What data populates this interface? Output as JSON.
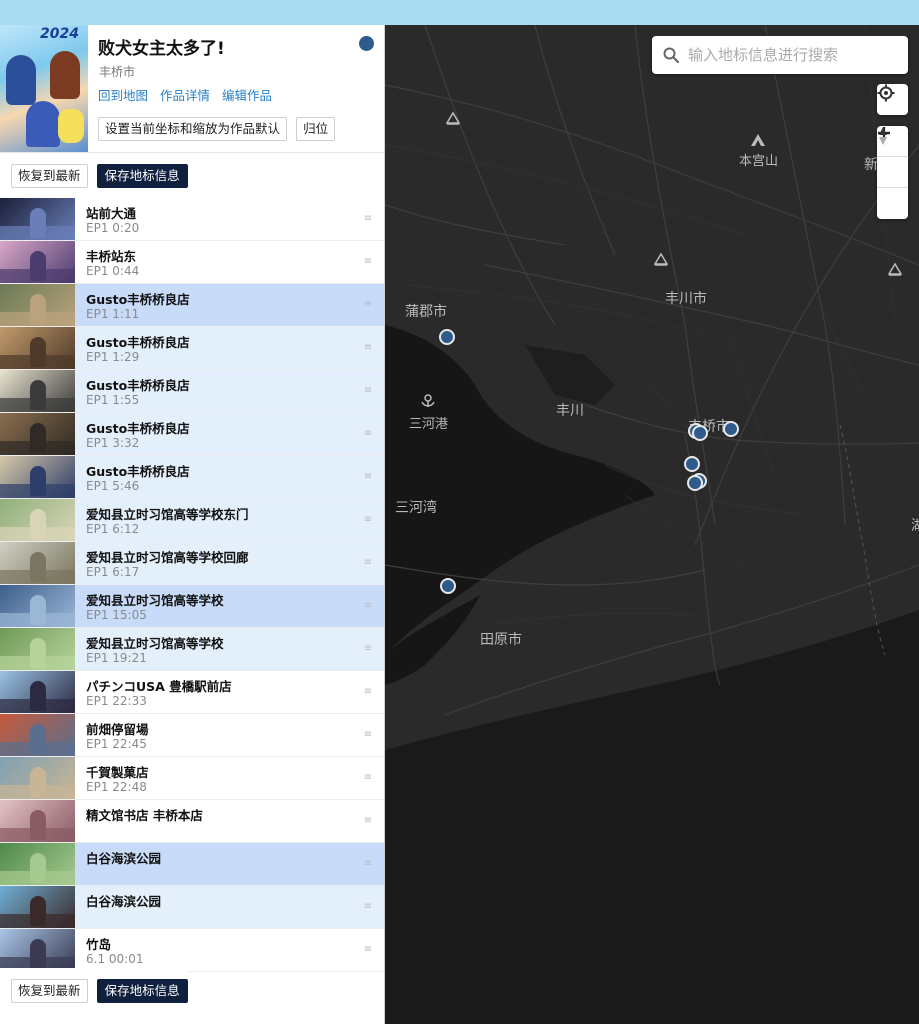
{
  "work": {
    "title": "败犬女主太多了!",
    "city": "丰桥市",
    "links": [
      "回到地图",
      "作品详情",
      "编辑作品"
    ],
    "set_default_label": "设置当前坐标和缩放为作品默认",
    "reset_label": "归位",
    "cover_year": "2024",
    "status_color": "#2f5b8c"
  },
  "actions": {
    "restore_label": "恢复到最新",
    "save_label": "保存地标信息"
  },
  "points": [
    {
      "name": "站前大通",
      "time": "EP1 0:20",
      "state": "none",
      "thumb": [
        "#1b1f3a",
        "#6a7fb8"
      ]
    },
    {
      "name": "丰桥站东",
      "time": "EP1 0:44",
      "state": "none",
      "thumb": [
        "#d9a7c7",
        "#4b3c6e"
      ]
    },
    {
      "name": "Gusto丰桥桥良店",
      "time": "EP1 1:11",
      "state": "hi",
      "thumb": [
        "#6b7a55",
        "#b9a27c"
      ]
    },
    {
      "name": "Gusto丰桥桥良店",
      "time": "EP1 1:29",
      "state": "sel",
      "thumb": [
        "#c29a6b",
        "#4e3a2a"
      ]
    },
    {
      "name": "Gusto丰桥桥良店",
      "time": "EP1 1:55",
      "state": "sel",
      "thumb": [
        "#e9e3cf",
        "#3b3b3b"
      ]
    },
    {
      "name": "Gusto丰桥桥良店",
      "time": "EP1 3:32",
      "state": "sel",
      "thumb": [
        "#8a6e4e",
        "#2f2a25"
      ]
    },
    {
      "name": "Gusto丰桥桥良店",
      "time": "EP1 5:46",
      "state": "sel",
      "thumb": [
        "#d8c9a9",
        "#2e3e6a"
      ]
    },
    {
      "name": "爱知县立时习馆高等学校东门",
      "time": "EP1 6:12",
      "state": "sel",
      "thumb": [
        "#8fb07a",
        "#d9d4b8"
      ]
    },
    {
      "name": "爱知县立时习馆高等学校回廊",
      "time": "EP1 6:17",
      "state": "sel",
      "thumb": [
        "#cfcfc3",
        "#7a7560"
      ]
    },
    {
      "name": "爱知县立时习馆高等学校",
      "time": "EP1 15:05",
      "state": "hi",
      "thumb": [
        "#3d5e8a",
        "#9bb7d6"
      ]
    },
    {
      "name": "爱知县立时习馆高等学校",
      "time": "EP1 19:21",
      "state": "sel",
      "thumb": [
        "#6f9a58",
        "#b7d39a"
      ]
    },
    {
      "name": "パチンコUSA 豊橋駅前店",
      "time": "EP1 22:33",
      "state": "none",
      "thumb": [
        "#9ac3e6",
        "#2c2a40"
      ]
    },
    {
      "name": "前畑停留場",
      "time": "EP1 22:45",
      "state": "none",
      "thumb": [
        "#c65a3a",
        "#5a6f8f"
      ]
    },
    {
      "name": "千賀製菓店",
      "time": "EP1 22:48",
      "state": "none",
      "thumb": [
        "#7fa0b3",
        "#c8b595"
      ]
    },
    {
      "name": "精文馆书店 丰桥本店",
      "time": "",
      "state": "none",
      "thumb": [
        "#e3c2c7",
        "#8a5b64"
      ]
    },
    {
      "name": "白谷海滨公园",
      "time": "",
      "state": "hi",
      "thumb": [
        "#4f8a4a",
        "#a6c98f"
      ]
    },
    {
      "name": "白谷海滨公园",
      "time": "",
      "state": "sel",
      "thumb": [
        "#6fb0d6",
        "#3a2a2a"
      ]
    },
    {
      "name": "竹岛",
      "time": "6.1  00:01",
      "state": "none",
      "thumb": [
        "#a9c6e6",
        "#3a3a52"
      ]
    }
  ],
  "map": {
    "search_placeholder": "输入地标信息进行搜索",
    "labels": [
      {
        "text": "本宫山",
        "key": "honguyama"
      },
      {
        "text": "丰川市",
        "key": "toyokawa-city"
      },
      {
        "text": "蒲郡市",
        "key": "gamagori"
      },
      {
        "text": "三河港",
        "key": "mikawa-port"
      },
      {
        "text": "丰川",
        "key": "toyokawa"
      },
      {
        "text": "丰桥市",
        "key": "toyohashi"
      },
      {
        "text": "三河湾",
        "key": "mikawa-bay"
      },
      {
        "text": "田原市",
        "key": "tahara"
      },
      {
        "text": "新",
        "key": "shin"
      },
      {
        "text": "湖",
        "key": "ko"
      }
    ],
    "icons": {
      "search": "search-icon",
      "locate": "crosshair-icon",
      "zoom_in": "plus-icon",
      "zoom_out": "minus-icon",
      "compass": "compass-icon"
    },
    "colors": {
      "land": "#2a2a2a",
      "water": "#161616",
      "road": "#3e3e3e",
      "pin": "#2f5b8c"
    }
  }
}
